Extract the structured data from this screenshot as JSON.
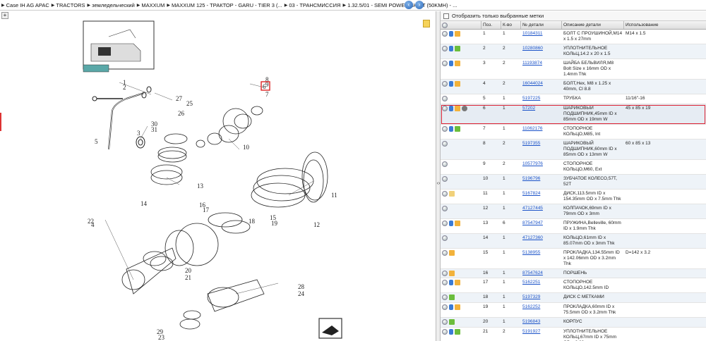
{
  "breadcrumb": [
    "Case IH AG APAC",
    "TRACTORS",
    "земледельческий",
    "MAXXUM",
    "MAXXUM 125 - ТРАКТОР - GARU - TIER 3 (...",
    "03 - ТРАНСМИССИЯ",
    "1.32.5/01 - SEMI POWER SHIFT (50KMH) - ..."
  ],
  "filter_label": "Отобразить только выбранные метки",
  "columns": [
    "",
    "Поз.",
    "К-во",
    "№ детали",
    "Описание детали",
    "Использование"
  ],
  "diagram_labels": [
    "1",
    "2",
    "3",
    "4",
    "5",
    "6",
    "7",
    "8",
    "9",
    "10",
    "11",
    "12",
    "13",
    "14",
    "15",
    "16",
    "17",
    "18",
    "19",
    "20",
    "21",
    "22",
    "23",
    "24",
    "25",
    "26",
    "27",
    "28",
    "29",
    "30",
    "31"
  ],
  "selected_callout": "6",
  "rows": [
    {
      "icons": [
        "add",
        "info",
        "box"
      ],
      "pos": "1",
      "qty": "1",
      "part": "10184311",
      "desc": "БОЛТ С ПРОУШИНОЙ,M14 x 1.5 x 27mm",
      "use": "M14 x 1.5"
    },
    {
      "icons": [
        "add",
        "info",
        "fwd"
      ],
      "pos": "2",
      "qty": "2",
      "part": "10280860",
      "desc": "УПЛОТНИТЕЛЬНОЕ КОЛЬЦ,14.2 x 20 x 1.5",
      "use": ""
    },
    {
      "icons": [
        "add",
        "info",
        "box"
      ],
      "pos": "3",
      "qty": "2",
      "part": "11193874",
      "desc": "ШАЙБА БЕЛЬВИЛЯ,M8 Bolt Size x 16mm OD x 1.4mm Thk",
      "use": ""
    },
    {
      "icons": [
        "add",
        "info",
        "box"
      ],
      "pos": "4",
      "qty": "2",
      "part": "16044024",
      "desc": "БОЛТ,Hex, M8 x 1.25 x 40mm, Cl 8.8",
      "use": ""
    },
    {
      "icons": [
        "add"
      ],
      "pos": "5",
      "qty": "1",
      "part": "5197225",
      "desc": "ТРУБКА",
      "use": "11/16\"-16"
    },
    {
      "icons": [
        "add",
        "info",
        "box",
        "gear"
      ],
      "pos": "6",
      "qty": "1",
      "part": "57202",
      "desc": "ШАРИКОВЫЙ ПОДШИПНИК,45mm ID x 85mm OD x 19mm W",
      "use": "45 x 85 x 19",
      "selected": true
    },
    {
      "icons": [
        "add",
        "info",
        "fwd"
      ],
      "pos": "7",
      "qty": "1",
      "part": "11062176",
      "desc": "СТОПОРНОЕ КОЛЬЦО,M85, Int",
      "use": ""
    },
    {
      "icons": [
        "add"
      ],
      "pos": "8",
      "qty": "2",
      "part": "5197355",
      "desc": "ШАРИКОВЫЙ ПОДШИПНИК,60mm ID x 85mm OD x 13mm W",
      "use": "60 x 85 x 13"
    },
    {
      "icons": [
        "add"
      ],
      "pos": "9",
      "qty": "2",
      "part": "10577976",
      "desc": "СТОПОРНОЕ КОЛЬЦО,M60, Ext",
      "use": ""
    },
    {
      "icons": [
        "add"
      ],
      "pos": "10",
      "qty": "1",
      "part": "5196796",
      "desc": "ЗУБЧАТОЕ КОЛЕСО,57T, 52T",
      "use": ""
    },
    {
      "icons": [
        "add",
        "fld"
      ],
      "pos": "11",
      "qty": "1",
      "part": "5167824",
      "desc": "ДИСК,113.5mm ID x 154.35mm OD x 7.5mm Thk",
      "use": ""
    },
    {
      "icons": [
        "add"
      ],
      "pos": "12",
      "qty": "1",
      "part": "47127445",
      "desc": "КОЛПАЧОК,69mm ID x 79mm OD x 3mm",
      "use": ""
    },
    {
      "icons": [
        "add",
        "info",
        "box"
      ],
      "pos": "13",
      "qty": "6",
      "part": "87547947",
      "desc": "ПРУЖИНА,Belleville, 60mm ID x 1.9mm Thk",
      "use": ""
    },
    {
      "icons": [
        "add"
      ],
      "pos": "14",
      "qty": "1",
      "part": "47127360",
      "desc": "КОЛЬЦО,61mm ID x 85.07mm OD x 3mm Thk",
      "use": ""
    },
    {
      "icons": [
        "add",
        "box"
      ],
      "pos": "15",
      "qty": "1",
      "part": "5138955",
      "desc": "ПРОКЛАДКА,134.55mm ID x 142.06mm OD x 3.2mm Thk",
      "use": "D=142 x 3.2"
    },
    {
      "icons": [
        "add",
        "box"
      ],
      "pos": "16",
      "qty": "1",
      "part": "87547624",
      "desc": "ПОРШЕНЬ",
      "use": ""
    },
    {
      "icons": [
        "add",
        "info",
        "box"
      ],
      "pos": "17",
      "qty": "1",
      "part": "5162251",
      "desc": "СТОПОРНОЕ КОЛЬЦО,142.5mm ID",
      "use": ""
    },
    {
      "icons": [
        "add",
        "fwd"
      ],
      "pos": "18",
      "qty": "1",
      "part": "5197329",
      "desc": "ДИСК С МЕТКАМИ",
      "use": ""
    },
    {
      "icons": [
        "add",
        "info",
        "box"
      ],
      "pos": "19",
      "qty": "1",
      "part": "5162252",
      "desc": "ПРОКЛАДКА,60mm ID x 75.5mm OD x 3.2mm Thk",
      "use": ""
    },
    {
      "icons": [
        "add",
        "fwd"
      ],
      "pos": "20",
      "qty": "1",
      "part": "5196843",
      "desc": "КОРПУС",
      "use": ""
    },
    {
      "icons": [
        "add",
        "info",
        "fwd"
      ],
      "pos": "21",
      "qty": "2",
      "part": "5191927",
      "desc": "УПЛОТНИТЕЛЬНОЕ КОЛЬЦ,67mm ID x 75mm OD x 2.60mm",
      "use": ""
    },
    {
      "icons": [
        "add",
        "fwd"
      ],
      "pos": "22",
      "qty": "1",
      "part": "47124533",
      "desc": "КОЛЛЕКТОР",
      "use": ""
    }
  ]
}
